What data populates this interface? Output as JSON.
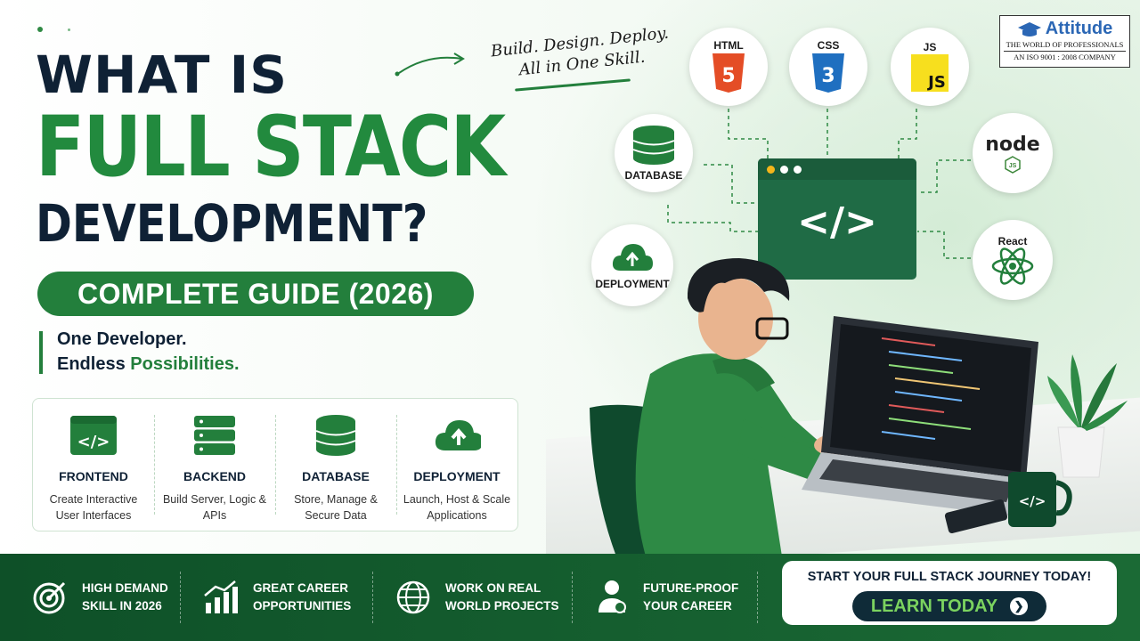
{
  "headline": {
    "line1": "WHAT IS",
    "line2": "FULL STACK",
    "line3": "DEVELOPMENT?",
    "pill": "COMPLETE GUIDE (2026)"
  },
  "tagline": {
    "line1": "One Developer.",
    "line2_prefix": "Endless ",
    "line2_highlight": "Possibilities."
  },
  "slogan": {
    "line1": "Build. Design. Deploy.",
    "line2": "All in One Skill."
  },
  "features": [
    {
      "icon": "code-window-icon",
      "title": "FRONTEND",
      "desc": "Create Interactive User Interfaces"
    },
    {
      "icon": "server-icon",
      "title": "BACKEND",
      "desc": "Build Server, Logic & APIs"
    },
    {
      "icon": "database-icon",
      "title": "DATABASE",
      "desc": "Store, Manage & Secure Data"
    },
    {
      "icon": "cloud-upload-icon",
      "title": "DEPLOYMENT",
      "desc": "Launch, Host & Scale Applications"
    }
  ],
  "tech": {
    "html": "HTML",
    "html_badge": "5",
    "css": "CSS",
    "css_badge": "3",
    "js": "JS",
    "js_badge": "JS",
    "database": "DATABASE",
    "deployment": "DEPLOYMENT",
    "node": "node",
    "node_badge": "JS",
    "react": "React",
    "code_symbol": "</>"
  },
  "logo": {
    "name": "Attitude",
    "sub1": "THE WORLD OF PROFESSIONALS",
    "sub2": "AN ISO 9001 : 2008 COMPANY"
  },
  "mug_symbol": "</>",
  "banner": {
    "items": [
      {
        "icon": "target-icon",
        "line1": "HIGH DEMAND",
        "line2": "SKILL IN 2026"
      },
      {
        "icon": "growth-chart-icon",
        "line1": "GREAT CAREER",
        "line2": "OPPORTUNITIES"
      },
      {
        "icon": "globe-icon",
        "line1": "WORK ON REAL",
        "line2": "WORLD PROJECTS"
      },
      {
        "icon": "career-person-icon",
        "line1": "FUTURE-PROOF",
        "line2": "YOUR CAREER"
      }
    ],
    "cta_title": "START YOUR FULL STACK JOURNEY TODAY!",
    "cta_button": "LEARN TODAY"
  },
  "colors": {
    "brand_green": "#237f3c",
    "navy": "#0f2135",
    "banner_green": "#0e5028",
    "cta_text": "#7bd35f"
  }
}
